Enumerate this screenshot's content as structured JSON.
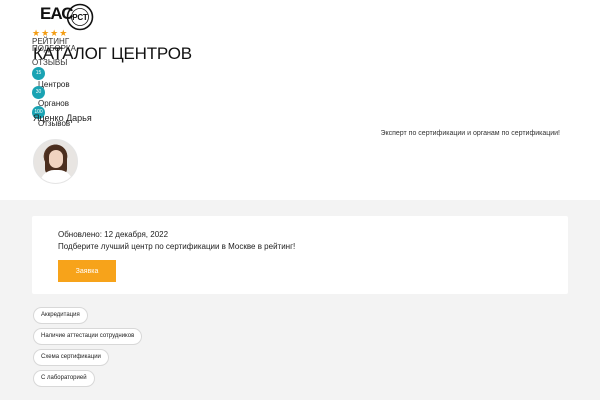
{
  "header": {
    "logo_eac": "ЕАС",
    "logo_rst": "РСТ"
  },
  "hero": {
    "rating": {
      "stars": "★★★★",
      "label": "РЕЙТИНГ",
      "caption": "ПОДБОРКА",
      "reviews_label": "ОТЗЫВЫ"
    },
    "title": "КАТАЛОГ ЦЕНТРОВ",
    "stats": [
      {
        "count": "15",
        "label": "Центров"
      },
      {
        "count": "30",
        "label": "Органов"
      },
      {
        "count": "100",
        "label": "Отзывов"
      }
    ],
    "author": {
      "name": "Яценко Дарья",
      "role": "Эксперт по сертификации и органам по сертификации!"
    }
  },
  "card": {
    "updated": "Обновлено: 12 декабря, 2022",
    "subtitle": "Подберите лучший центр по сертификации в Москве в рейтинг!",
    "button_label": "Заявка"
  },
  "filters": [
    "Аккредитация",
    "Наличие аттестации сотрудников",
    "Схема сертификации",
    "С лабораторией"
  ],
  "colors": {
    "accent": "#f7a31a",
    "badge": "#1aa3b3",
    "star": "#f39c12",
    "section_bg": "#f3f3f3"
  }
}
